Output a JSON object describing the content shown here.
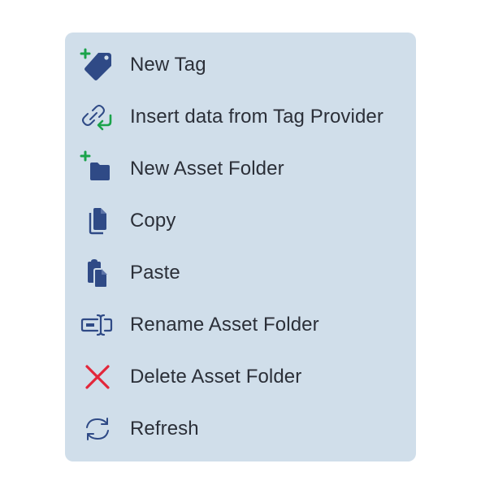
{
  "context_menu": {
    "items": [
      {
        "label": "New Tag",
        "icon": "new-tag-icon"
      },
      {
        "label": "Insert data from Tag Provider",
        "icon": "link-insert-icon"
      },
      {
        "label": "New Asset Folder",
        "icon": "new-folder-icon"
      },
      {
        "label": "Copy",
        "icon": "copy-icon"
      },
      {
        "label": "Paste",
        "icon": "paste-icon"
      },
      {
        "label": "Rename Asset Folder",
        "icon": "rename-icon"
      },
      {
        "label": "Delete Asset Folder",
        "icon": "delete-icon"
      },
      {
        "label": "Refresh",
        "icon": "refresh-icon"
      }
    ]
  },
  "colors": {
    "menu_background": "#d0deea",
    "icon_primary": "#2f4a86",
    "add_green": "#1aa34a",
    "delete_red": "#e3263a",
    "text": "#2b2f38"
  }
}
